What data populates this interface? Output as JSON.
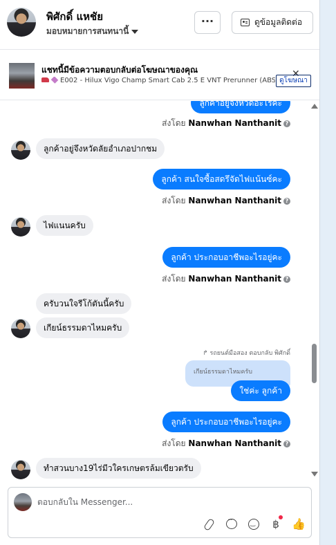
{
  "header": {
    "name": "พิศักดิ์ แหชัย",
    "assignee": "มอบหมายการสนทนานี้",
    "more_label": "···",
    "contact_button": "ดูข้อมูลติดต่อ"
  },
  "banner": {
    "title": "แชทนี้มีข้อความตอบกลับต่อโฆษณาของคุณ",
    "ad_line": "E002 - Hilux Vigo Champ Smart Cab 2.5 E VNT Prerunner (ABS) ...",
    "close": "✕",
    "view_ad": "ดูโฆษณา"
  },
  "messages": {
    "out_top_partial": "ลูกค้าอยู่จังหวัดอะไรคะ",
    "sent1_prefix": "ส่งโดย",
    "sent1_name": "Nanwhan Nanthanit",
    "in1": "ลูกค้าอยู่จึงหวัดลัยอำเภอปากชม",
    "out2": "ลูกค้า สนใจซื้อสดรึจัดไฟแน้นซ์คะ",
    "sent2_prefix": "ส่งโดย",
    "sent2_name": "Nanwhan Nanthanit",
    "in2": "ไฟแนนครับ",
    "out3": "ลูกค้า ประกอบอาชีพอะไรอยู่คะ",
    "sent3_prefix": "ส่งโดย",
    "sent3_name": "Nanwhan Nanthanit",
    "in3a": "ครับวนใจรีโก้ตันนี้ครับ",
    "in3b": "เกียน์ธรรมดาไหมครับ",
    "reply_label": "รถยนต์มือสอง ตอบกลับ พิศักดิ์",
    "reply_quote": "เกียน์ธรรมดาไหมครับ",
    "out4": "ใช่ค่ะ  ลูกค้า",
    "out5": "ลูกค้า ประกอบอาชีพอะไรอยู่คะ",
    "sent5_prefix": "ส่งโดย",
    "sent5_name": "Nanwhan Nanthanit",
    "in5": "ทำสวนบาง19ไร่มีวใครเกษตรล้มเขียวตรับ"
  },
  "composer": {
    "placeholder": "ตอบกลับใน Messenger...",
    "baht_icon": "฿",
    "like_icon": "👍"
  },
  "colors": {
    "accent": "#0a7cff",
    "incoming": "#eeeff2",
    "reply_quote_bg": "#cde1fb"
  },
  "icons": [
    "more-icon",
    "contact-card-icon",
    "close-icon",
    "info-icon",
    "attach-icon",
    "chat-icon",
    "emoji-icon",
    "baht-icon",
    "like-icon",
    "reply-arrow-icon"
  ]
}
